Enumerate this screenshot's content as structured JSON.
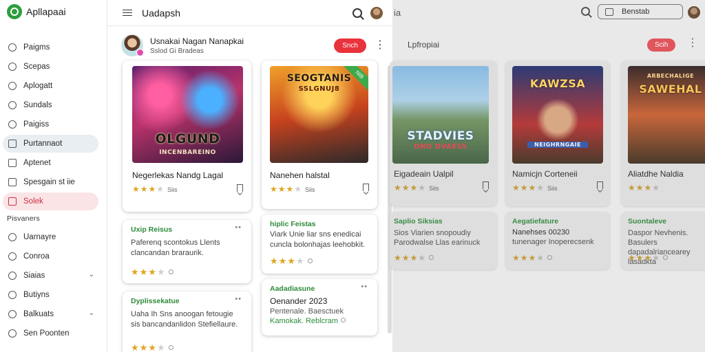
{
  "app": {
    "name": "Apllapaai"
  },
  "sidebar": {
    "items": [
      {
        "label": "Paigms"
      },
      {
        "label": "Scepas"
      },
      {
        "label": "Aplogatt"
      },
      {
        "label": "Sundals"
      },
      {
        "label": "Paigiss"
      },
      {
        "label": "Purtannaot"
      },
      {
        "label": "Aptenet"
      },
      {
        "label": "Spesgain st iie"
      },
      {
        "label": "Solek"
      }
    ],
    "section_label": "Pisvaners",
    "section_items": [
      {
        "label": "Uarnayre"
      },
      {
        "label": "Conroa"
      },
      {
        "label": "Siaias"
      },
      {
        "label": "Butiyns"
      },
      {
        "label": "Balkuats"
      },
      {
        "label": "Sen Poonten"
      }
    ]
  },
  "topbar": {
    "title": "Uadapsh"
  },
  "profile": {
    "name": "Usnakai Nagan Nanapkai",
    "subtitle": "Sslod Gi Bradeas",
    "pill_label": "Snch"
  },
  "games": [
    {
      "title": "Negerlekas Nandg Lagal",
      "art_title": "OLGUND",
      "art_subtitle": "INCENBAREINO",
      "rating": 3,
      "rating_label": "Siis"
    },
    {
      "title": "Nanehen halstal",
      "art_title": "SEOGTANIS",
      "art_subtitle": "SSLGNUJ8",
      "ribbon": "NIB",
      "rating": 3,
      "rating_label": "Siis"
    }
  ],
  "notes": [
    {
      "heading": "Uxip Reisus",
      "body": "Paferenq scontokus Llents clancandan braraurik.",
      "rating": 3
    },
    {
      "heading": "hiplic Feistas",
      "body": "Viark Unie liar sns enedicai cuncla bolonhajas leehobkit.",
      "rating": 3
    },
    {
      "heading": "Dyplissekatue",
      "body": "Uaha Ih Sns anoogan fetougie sis bancandanlidon Stefiellaure.",
      "rating": 3
    },
    {
      "heading": "Aadadiasune",
      "body_line1": "Oenander 2023",
      "body_line2": "Pentenale. Baesctuek",
      "body_line3": "Kamokak. Reblcram"
    }
  ],
  "background_panel": {
    "tab_label": "ia",
    "search_label": "Benstab",
    "profile_name": "Lpfropiai",
    "pill_label": "Scih",
    "games": [
      {
        "title": "Eigadeain Ualpil",
        "art_title": "STADVIES",
        "art_subtitle": "DNO DVAESS",
        "rating": 3,
        "rating_label": "Siis"
      },
      {
        "title": "Namicjn Corteneii",
        "art_title": "KAWZSA",
        "art_subtitle": "NEIGHRNGAIE",
        "rating": 3,
        "rating_label": "Siis"
      },
      {
        "title": "Aliatdhe Naldia",
        "art_title": "SAWEHAL",
        "art_subtitle": "ARBECHALIGE",
        "rating": 3
      }
    ],
    "notes": [
      {
        "heading": "Saplio Siksias",
        "body": "Sios Viarien snopoudiy Parodwalse Llas earinuck"
      },
      {
        "heading": "Aegatiefature",
        "body_line1": "Nanehses 00230",
        "body_line2": "tunenager Inoperecsenk"
      },
      {
        "heading": "Suontaleve",
        "body": "Daspor Nevhenis. Basulers dapadalriancearey lasadkta"
      }
    ]
  }
}
